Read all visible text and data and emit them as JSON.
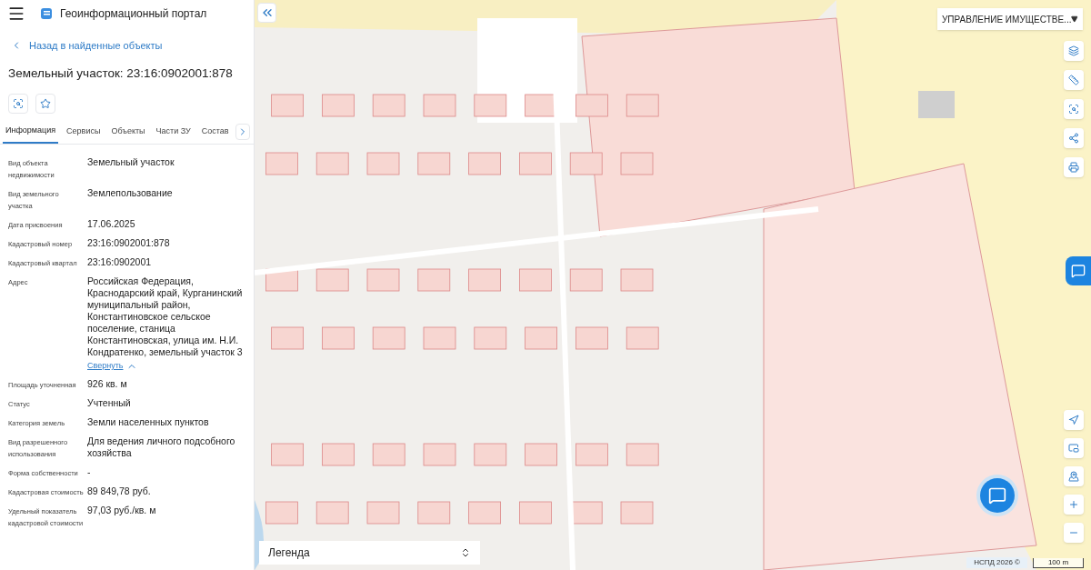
{
  "header": {
    "title": "Геоинформационный портал"
  },
  "back_link": "Назад в найденные объекты",
  "object_title": "Земельный участок: 23:16:0902001:878",
  "tabs": [
    {
      "label": "Информация",
      "selected": true
    },
    {
      "label": "Сервисы",
      "selected": false
    },
    {
      "label": "Объекты",
      "selected": false
    },
    {
      "label": "Части ЗУ",
      "selected": false
    },
    {
      "label": "Состав",
      "selected": false
    }
  ],
  "fields": [
    {
      "label": "Вид объекта недвижимости",
      "value": "Земельный участок"
    },
    {
      "label": "Вид земельного участка",
      "value": "Землепользование"
    },
    {
      "label": "Дата присвоения",
      "value": "17.06.2025"
    },
    {
      "label": "Кадастровый номер",
      "value": "23:16:0902001:878"
    },
    {
      "label": "Кадастровый квартал",
      "value": "23:16:0902001"
    },
    {
      "label": "Адрес",
      "value": "Российская Федерация, Краснодарский край, Курганинский муниципальный район, Константиновское сельское поселение, станица Константиновская, улица им. Н.И. Кондратенко, земельный участок 3",
      "toggle": "Свернуть"
    },
    {
      "label": "Площадь уточненная",
      "value": "926 кв. м"
    },
    {
      "label": "Статус",
      "value": "Учтенный"
    },
    {
      "label": "Категория земель",
      "value": "Земли населенных пунктов"
    },
    {
      "label": "Вид разрешенного использования",
      "value": "Для ведения личного подсобного хозяйства"
    },
    {
      "label": "Форма собственности",
      "value": "-"
    },
    {
      "label": "Кадастровая стоимость",
      "value": "89 849,78 руб."
    },
    {
      "label": "Удельный показатель кадастровой стоимости",
      "value": "97,03 руб./кв. м"
    }
  ],
  "map": {
    "layer_select": "УПРАВЛЕНИЕ ИМУЩЕСТВЕ...",
    "legend": "Легенда",
    "attribution": "НСПД 2026 ©",
    "scale": "100 m"
  }
}
